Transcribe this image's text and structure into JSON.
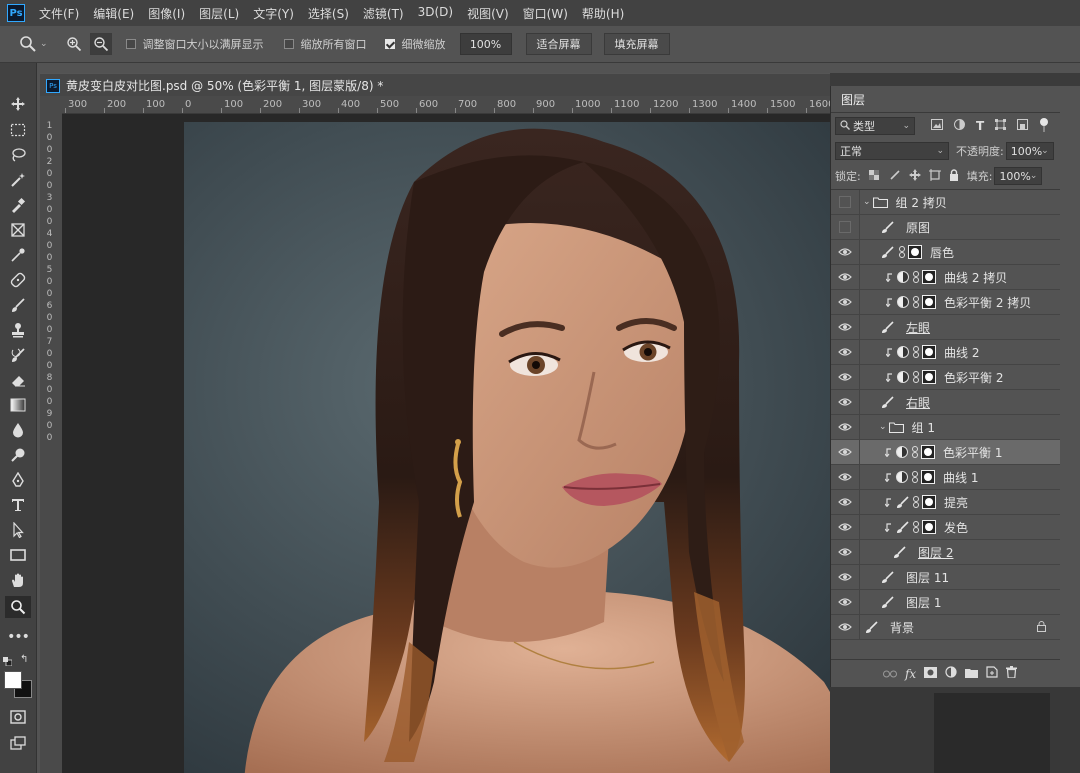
{
  "menubar": {
    "logo": "Ps",
    "items": [
      "文件(F)",
      "编辑(E)",
      "图像(I)",
      "图层(L)",
      "文字(Y)",
      "选择(S)",
      "滤镜(T)",
      "3D(D)",
      "视图(V)",
      "窗口(W)",
      "帮助(H)"
    ]
  },
  "options": {
    "resize_windows": "调整窗口大小以满屏显示",
    "zoom_all": "缩放所有窗口",
    "scrubby_zoom": "细微缩放",
    "zoom_value": "100%",
    "fit_screen": "适合屏幕",
    "fill_screen": "填充屏幕"
  },
  "document": {
    "title": "黄皮变白皮对比图.psd @ 50% (色彩平衡 1, 图层蒙版/8) *",
    "ruler_h": [
      "300",
      "200",
      "100",
      "0",
      "100",
      "200",
      "300",
      "400",
      "500",
      "600",
      "700",
      "800",
      "900",
      "1000",
      "1100",
      "1200",
      "1300",
      "1400",
      "1500",
      "1600"
    ],
    "ruler_v": [
      "1",
      "0",
      "0",
      "2",
      "0",
      "0",
      "3",
      "0",
      "0",
      "4",
      "0",
      "0",
      "5",
      "0",
      "0",
      "6",
      "0",
      "0",
      "7",
      "0",
      "0",
      "8",
      "0",
      "0",
      "9",
      "0",
      "0"
    ]
  },
  "layers_panel": {
    "tab": "图层",
    "filter_kind": "类型",
    "blend_mode": "正常",
    "opacity_label": "不透明度:",
    "opacity": "100%",
    "lock_label": "锁定:",
    "fill_label": "填充:",
    "fill": "100%",
    "layers": [
      {
        "name": "组 2 拷贝",
        "type": "group",
        "visible": false,
        "indent": 0
      },
      {
        "name": "原图",
        "type": "brush",
        "visible": false,
        "indent": 0
      },
      {
        "name": "唇色",
        "type": "brush-mask",
        "visible": true,
        "indent": 0
      },
      {
        "name": "曲线 2 拷贝",
        "type": "adj",
        "visible": true,
        "indent": 0
      },
      {
        "name": "色彩平衡 2 拷贝",
        "type": "adj",
        "visible": true,
        "indent": 0
      },
      {
        "name": "左眼",
        "type": "brush",
        "visible": true,
        "indent": 0,
        "underline": true
      },
      {
        "name": "曲线 2",
        "type": "adj",
        "visible": true,
        "indent": 0
      },
      {
        "name": "色彩平衡 2",
        "type": "adj",
        "visible": true,
        "indent": 0
      },
      {
        "name": "右眼",
        "type": "brush",
        "visible": true,
        "indent": 0,
        "underline": true
      },
      {
        "name": "组 1",
        "type": "group-open",
        "visible": true,
        "indent": 0
      },
      {
        "name": "色彩平衡 1",
        "type": "adj",
        "visible": true,
        "indent": 1,
        "selected": true
      },
      {
        "name": "曲线 1",
        "type": "adj",
        "visible": true,
        "indent": 1
      },
      {
        "name": "提亮",
        "type": "brush-clip",
        "visible": true,
        "indent": 1
      },
      {
        "name": "发色",
        "type": "brush-clip",
        "visible": true,
        "indent": 1
      },
      {
        "name": "图层 2",
        "type": "brush",
        "visible": true,
        "indent": 1,
        "underline": true
      },
      {
        "name": "图层 11",
        "type": "brush",
        "visible": true,
        "indent": 0
      },
      {
        "name": "图层 1",
        "type": "brush",
        "visible": true,
        "indent": 0
      },
      {
        "name": "背景",
        "type": "background",
        "visible": true,
        "indent": 0
      }
    ]
  }
}
